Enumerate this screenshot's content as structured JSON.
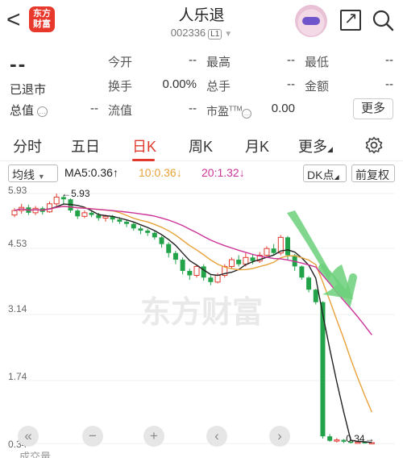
{
  "header": {
    "back": "<",
    "logo_text": "东方\n财富",
    "title": "人乐退",
    "code": "002336",
    "level": "L1"
  },
  "quote": {
    "price": "--",
    "status": "已退市",
    "zongzhi_label": "总值",
    "zongzhi_value": "--",
    "rows": [
      [
        {
          "label": "今开",
          "value": "--"
        },
        {
          "label": "最高",
          "value": "--"
        },
        {
          "label": "最低",
          "value": "--"
        }
      ],
      [
        {
          "label": "换手",
          "value": "0.00%"
        },
        {
          "label": "总手",
          "value": "--"
        },
        {
          "label": "金额",
          "value": "--"
        }
      ],
      [
        {
          "label": "流值",
          "value": "--"
        },
        {
          "label": "市盈",
          "sup": "TTM",
          "value": "0.00"
        }
      ]
    ],
    "more_label": "更多"
  },
  "tabs": [
    {
      "label": "分时",
      "active": false
    },
    {
      "label": "五日",
      "active": false
    },
    {
      "label": "日K",
      "active": true
    },
    {
      "label": "周K",
      "active": false
    },
    {
      "label": "月K",
      "active": false
    },
    {
      "label": "更多",
      "active": false
    }
  ],
  "indicators": {
    "ma_select": "均线",
    "ma5": "MA5:0.36",
    "ma10": "10:0.36",
    "ma20": "20:1.32",
    "dk_select": "DK点",
    "fq_select": "前复权",
    "colors": {
      "ma5": "#222222",
      "ma10": "#e8a23a",
      "ma20": "#cc3399",
      "up": "#e03a2f",
      "down": "#22a349"
    }
  },
  "chart_data": {
    "type": "candlestick",
    "y_ticks": [
      "5.93",
      "4.53",
      "3.14",
      "1.74",
      "0.34"
    ],
    "high_label": "5.93",
    "low_label": "0.34",
    "watermark": "东方财富",
    "ylim": [
      0.34,
      5.93
    ],
    "candles": [
      [
        5.45,
        5.55,
        5.4,
        5.6
      ],
      [
        5.55,
        5.62,
        5.48,
        5.7
      ],
      [
        5.62,
        5.5,
        5.45,
        5.68
      ],
      [
        5.5,
        5.6,
        5.45,
        5.65
      ],
      [
        5.6,
        5.52,
        5.46,
        5.64
      ],
      [
        5.52,
        5.7,
        5.5,
        5.75
      ],
      [
        5.7,
        5.85,
        5.65,
        5.93
      ],
      [
        5.85,
        5.8,
        5.7,
        5.88
      ],
      [
        5.8,
        5.55,
        5.5,
        5.82
      ],
      [
        5.55,
        5.42,
        5.36,
        5.58
      ],
      [
        5.42,
        5.5,
        5.38,
        5.55
      ],
      [
        5.5,
        5.45,
        5.4,
        5.56
      ],
      [
        5.45,
        5.38,
        5.32,
        5.5
      ],
      [
        5.38,
        5.42,
        5.3,
        5.46
      ],
      [
        5.42,
        5.35,
        5.28,
        5.45
      ],
      [
        5.35,
        5.3,
        5.25,
        5.4
      ],
      [
        5.3,
        5.25,
        5.18,
        5.34
      ],
      [
        5.25,
        5.15,
        5.1,
        5.28
      ],
      [
        5.15,
        5.1,
        5.02,
        5.2
      ],
      [
        5.1,
        5.05,
        4.98,
        5.14
      ],
      [
        5.05,
        4.95,
        4.9,
        5.08
      ],
      [
        4.95,
        4.8,
        4.72,
        4.98
      ],
      [
        4.8,
        4.6,
        4.5,
        4.84
      ],
      [
        4.6,
        4.45,
        4.35,
        4.65
      ],
      [
        4.45,
        4.2,
        4.12,
        4.5
      ],
      [
        4.2,
        4.1,
        4.0,
        4.25
      ],
      [
        4.1,
        4.3,
        4.05,
        4.35
      ],
      [
        4.3,
        4.05,
        3.98,
        4.35
      ],
      [
        4.05,
        3.95,
        3.88,
        4.1
      ],
      [
        3.95,
        4.1,
        3.92,
        4.15
      ],
      [
        4.1,
        4.3,
        4.05,
        4.35
      ],
      [
        4.3,
        4.45,
        4.25,
        4.5
      ],
      [
        4.45,
        4.35,
        4.3,
        4.55
      ],
      [
        4.35,
        4.5,
        4.3,
        4.6
      ],
      [
        4.5,
        4.42,
        4.35,
        4.58
      ],
      [
        4.42,
        4.55,
        4.38,
        4.62
      ],
      [
        4.55,
        4.7,
        4.5,
        4.75
      ],
      [
        4.7,
        4.6,
        4.55,
        4.8
      ],
      [
        4.6,
        4.95,
        4.55,
        5.0
      ],
      [
        4.95,
        4.55,
        4.45,
        4.98
      ],
      [
        4.55,
        4.3,
        4.2,
        4.58
      ],
      [
        4.3,
        4.05,
        4.0,
        4.32
      ],
      [
        4.05,
        3.78,
        3.72,
        4.08
      ],
      [
        3.78,
        3.5,
        3.45,
        3.8
      ],
      [
        3.5,
        0.5,
        0.45,
        3.52
      ],
      [
        0.5,
        0.4,
        0.38,
        0.55
      ],
      [
        0.4,
        0.42,
        0.36,
        0.46
      ],
      [
        0.42,
        0.38,
        0.35,
        0.44
      ],
      [
        0.38,
        0.36,
        0.34,
        0.4
      ],
      [
        0.36,
        0.37,
        0.34,
        0.39
      ],
      [
        0.37,
        0.35,
        0.34,
        0.38
      ],
      [
        0.35,
        0.36,
        0.34,
        0.37
      ]
    ]
  },
  "controls": [
    "«",
    "−",
    "+",
    "‹",
    "›"
  ],
  "bottom_text": "成交量"
}
